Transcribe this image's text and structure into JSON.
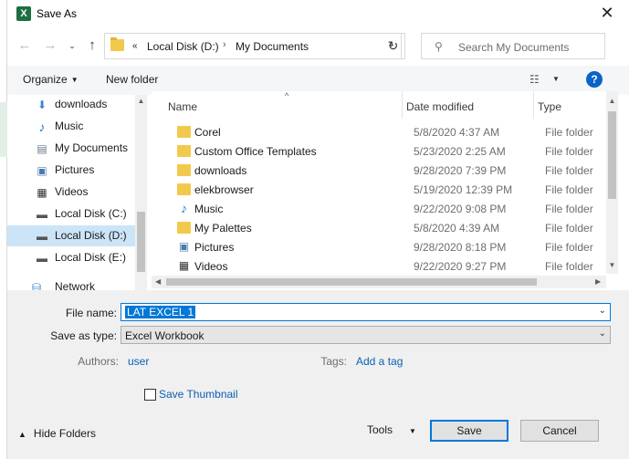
{
  "window": {
    "title": "Save As",
    "app_icon": "excel-icon",
    "close": "✕"
  },
  "address": {
    "overflow": "«",
    "crumbs": [
      "Local Disk (D:)",
      "My Documents"
    ],
    "separator": "›"
  },
  "search": {
    "placeholder": "Search My Documents"
  },
  "toolbar": {
    "organize": "Organize",
    "new_folder": "New folder"
  },
  "nav_pane": {
    "items": [
      {
        "label": "downloads",
        "icon": "download-arrow-icon",
        "selected": false
      },
      {
        "label": "Music",
        "icon": "music-note-icon",
        "selected": false
      },
      {
        "label": "My Documents",
        "icon": "document-icon",
        "selected": false
      },
      {
        "label": "Pictures",
        "icon": "picture-icon",
        "selected": false
      },
      {
        "label": "Videos",
        "icon": "film-icon",
        "selected": false
      },
      {
        "label": "Local Disk (C:)",
        "icon": "drive-icon",
        "selected": false
      },
      {
        "label": "Local Disk (D:)",
        "icon": "drive-icon",
        "selected": true
      },
      {
        "label": "Local Disk (E:)",
        "icon": "drive-icon",
        "selected": false
      },
      {
        "label": "Network",
        "icon": "network-icon",
        "selected": false
      }
    ]
  },
  "file_list": {
    "columns": {
      "name": "Name",
      "date": "Date modified",
      "type": "Type"
    },
    "rows": [
      {
        "name": "Corel",
        "date": "5/8/2020 4:37 AM",
        "type": "File folder",
        "icon": "folder-icon"
      },
      {
        "name": "Custom Office Templates",
        "date": "5/23/2020 2:25 AM",
        "type": "File folder",
        "icon": "folder-icon"
      },
      {
        "name": "downloads",
        "date": "9/28/2020 7:39 PM",
        "type": "File folder",
        "icon": "folder-icon"
      },
      {
        "name": "elekbrowser",
        "date": "5/19/2020 12:39 PM",
        "type": "File folder",
        "icon": "folder-icon"
      },
      {
        "name": "Music",
        "date": "9/22/2020 9:08 PM",
        "type": "File folder",
        "icon": "music-note-icon"
      },
      {
        "name": "My Palettes",
        "date": "5/8/2020 4:39 AM",
        "type": "File folder",
        "icon": "folder-icon"
      },
      {
        "name": "Pictures",
        "date": "9/28/2020 8:18 PM",
        "type": "File folder",
        "icon": "picture-icon"
      },
      {
        "name": "Videos",
        "date": "9/22/2020 9:27 PM",
        "type": "File folder",
        "icon": "film-icon"
      }
    ]
  },
  "form": {
    "file_name_label": "File name:",
    "file_name_value": "LAT EXCEL 1",
    "save_type_label": "Save as type:",
    "save_type_value": "Excel Workbook",
    "authors_label": "Authors:",
    "authors_value": "user",
    "tags_label": "Tags:",
    "tags_value": "Add a tag",
    "thumbnail_label": "Save Thumbnail"
  },
  "footer": {
    "hide_folders": "Hide Folders",
    "tools": "Tools",
    "save": "Save",
    "cancel": "Cancel"
  },
  "colors": {
    "accent": "#0078d7",
    "selection": "#cce4f7",
    "link": "#0a5fb4",
    "folder": "#f2c94c"
  }
}
